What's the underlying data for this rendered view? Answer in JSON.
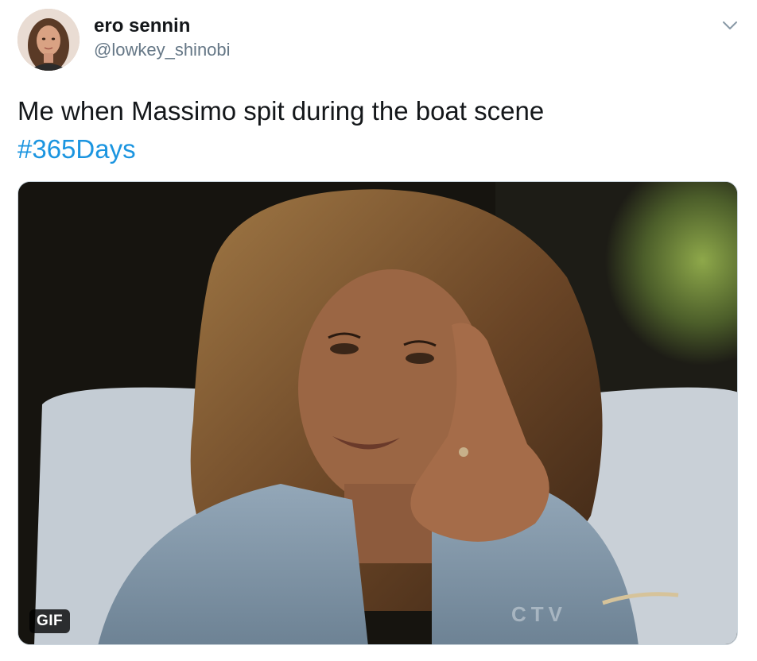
{
  "author": {
    "display_name": "ero sennin",
    "handle": "@lowkey_shinobi",
    "avatar_icon": "profile-photo"
  },
  "menu": {
    "icon": "chevron-down-icon"
  },
  "tweet": {
    "text": "Me when Massimo spit during the boat scene",
    "hashtag": "#365Days",
    "hashtag_color": "#1b95e0"
  },
  "media": {
    "badge": "GIF",
    "watermark": "CTV"
  },
  "colors": {
    "text": "#14171a",
    "secondary": "#657786",
    "link": "#1b95e0"
  }
}
